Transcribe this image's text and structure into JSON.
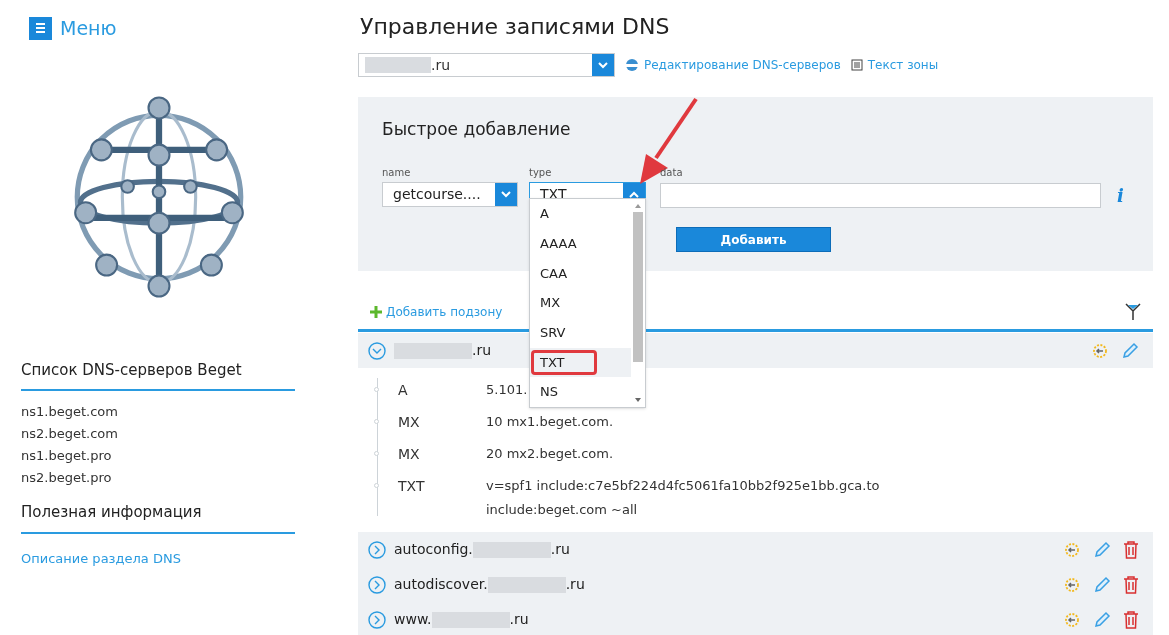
{
  "menu": {
    "label": "Меню"
  },
  "sidebar": {
    "sections": [
      {
        "title": "Список DNS-серверов Beget",
        "items": [
          "ns1.beget.com",
          "ns2.beget.com",
          "ns1.beget.pro",
          "ns2.beget.pro"
        ]
      },
      {
        "title": "Полезная информация",
        "links": [
          "Описание раздела DNS"
        ]
      }
    ]
  },
  "page_title": "Управление записями DNS",
  "domain_select": {
    "suffix": ".ru"
  },
  "links": [
    "Редактирование DNS-серверов",
    "Текст зоны"
  ],
  "quick_add": {
    "title": "Быстрое добавление",
    "fields": [
      {
        "label": "name",
        "kind": "select",
        "value": "getcourse....",
        "expanded": false
      },
      {
        "label": "type",
        "kind": "select",
        "value": "TXT",
        "expanded": true
      },
      {
        "label": "data",
        "kind": "textarea",
        "info": "i"
      }
    ],
    "options": [
      {
        "label": "A",
        "selected": false
      },
      {
        "label": "AAAA",
        "selected": false
      },
      {
        "label": "CAA",
        "selected": false
      },
      {
        "label": "MX",
        "selected": false
      },
      {
        "label": "SRV",
        "selected": false
      },
      {
        "label": "TXT",
        "selected": true
      },
      {
        "label": "NS",
        "selected": false
      }
    ],
    "button": "Добавить"
  },
  "add_subzone": "Добавить подзону",
  "zones": [
    {
      "suffix": ".ru",
      "expanded": true,
      "deletable": false,
      "records": [
        {
          "type": "A",
          "lines": [
            "5.101."
          ]
        },
        {
          "type": "MX",
          "lines": [
            "10 mx1.beget.com."
          ]
        },
        {
          "type": "MX",
          "lines": [
            "20 mx2.beget.com."
          ]
        },
        {
          "type": "TXT",
          "lines": [
            "v=spf1 include:c7e5bf224d4fc5061fa10bb2f925e1bb.gca.to",
            "include:beget.com ~all"
          ]
        }
      ]
    },
    {
      "prefix": "autoconfig.",
      "suffix": ".ru",
      "expanded": false,
      "deletable": true
    },
    {
      "prefix": "autodiscover.",
      "suffix": ".ru",
      "expanded": false,
      "deletable": true
    },
    {
      "prefix": "www.",
      "suffix": ".ru",
      "expanded": false,
      "deletable": true
    }
  ]
}
